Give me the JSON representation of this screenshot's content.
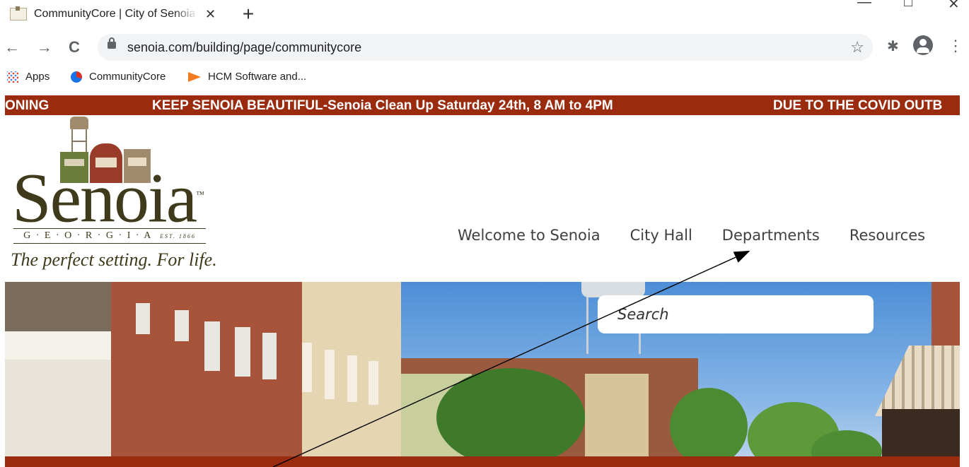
{
  "browser": {
    "tab_title": "CommunityCore | City of Senoia",
    "tab_close": "✕",
    "new_tab": "+",
    "url": "senoia.com/building/page/communitycore",
    "back": "←",
    "forward": "→",
    "reload": "C",
    "star": "☆",
    "menu": "⋮",
    "bookmarks": [
      "Apps",
      "CommunityCore",
      "HCM Software and..."
    ]
  },
  "ticker": {
    "items": [
      "ONING",
      "KEEP SENOIA BEAUTIFUL-Senoia Clean Up Saturday 24th, 8 AM to 4PM",
      "DUE TO THE COVID OUTB"
    ]
  },
  "logo": {
    "word": "Senoia",
    "trademark": "™",
    "georgia": "G · E · O · R · G · I · A",
    "est": "EST. 1866",
    "tagline": "The perfect setting. For life."
  },
  "nav": {
    "items": [
      "Welcome to Senoia",
      "City Hall",
      "Departments",
      "Resources"
    ]
  },
  "search": {
    "placeholder": "Search"
  },
  "colors": {
    "ticker_bg": "#9b2b0e",
    "logo_text": "#3f3a1c",
    "nav_text": "#404040"
  }
}
